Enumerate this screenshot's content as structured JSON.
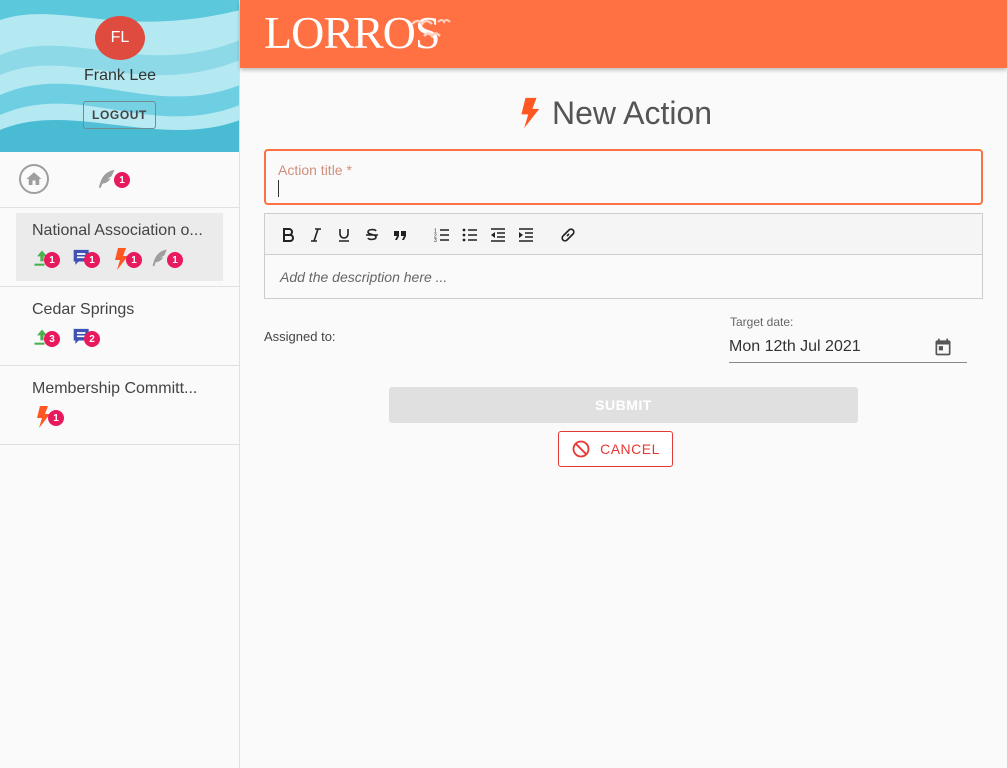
{
  "user": {
    "initials": "FL",
    "name": "Frank Lee",
    "logout_label": "LOGOUT"
  },
  "nav": {
    "home_icon": "home-icon",
    "feather_icon": "feather-icon",
    "feather_badge": "1"
  },
  "groups": [
    {
      "name": "National Association o...",
      "active": true,
      "stats": [
        {
          "icon": "tasks-icon",
          "count": "1"
        },
        {
          "icon": "comments-icon",
          "count": "1"
        },
        {
          "icon": "action-bolt-icon",
          "count": "1"
        },
        {
          "icon": "feather-icon",
          "count": "1"
        }
      ]
    },
    {
      "name": "Cedar Springs",
      "stats": [
        {
          "icon": "tasks-icon",
          "count": "3"
        },
        {
          "icon": "comments-icon",
          "count": "2"
        }
      ]
    },
    {
      "name": "Membership Committ...",
      "stats": [
        {
          "icon": "action-bolt-icon",
          "count": "1"
        }
      ]
    }
  ],
  "header": {
    "logo_text": "LORROS"
  },
  "page": {
    "title": "New Action"
  },
  "form": {
    "title_label": "Action title *",
    "description_placeholder": "Add the description here ...",
    "assigned_label": "Assigned to:",
    "target_date_label": "Target date:",
    "target_date_value": "Mon 12th Jul 2021",
    "submit_label": "SUBMIT",
    "cancel_label": "CANCEL"
  },
  "toolbar_buttons": [
    "bold",
    "italic",
    "underline",
    "strikethrough",
    "blockquote",
    "ordered-list",
    "bullet-list",
    "outdent",
    "indent",
    "link"
  ],
  "colors": {
    "accent": "#ff7043",
    "badge": "#e8195c",
    "danger": "#e53935",
    "tasks": "#4caf50",
    "comments": "#3f51b5"
  }
}
